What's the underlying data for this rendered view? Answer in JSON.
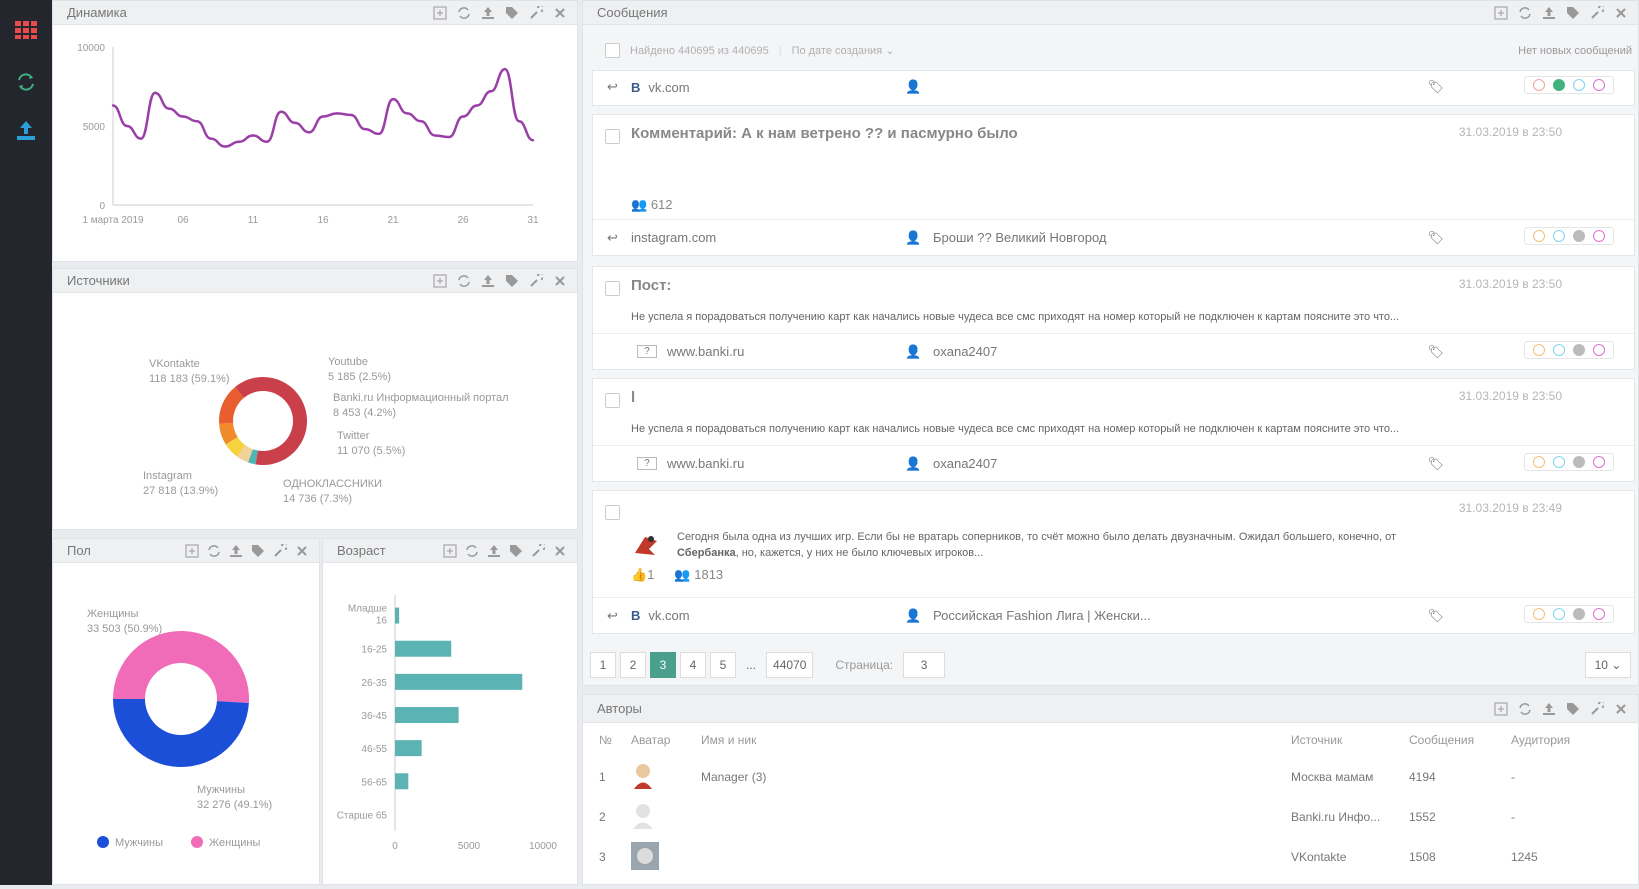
{
  "sidebar": {
    "icons": [
      "grid-icon",
      "refresh-icon",
      "upload-icon"
    ],
    "colors": {
      "grid": "#e84b4b",
      "refresh": "#3fb27f",
      "upload": "#2a9fd8"
    }
  },
  "dynamics": {
    "title": "Динамика",
    "chart_data": {
      "type": "line",
      "x": [
        "1 марта 2019",
        "",
        "",
        "",
        "",
        "06",
        "",
        "",
        "",
        "",
        "11",
        "",
        "",
        "",
        "",
        "16",
        "",
        "",
        "",
        "",
        "21",
        "",
        "",
        "",
        "",
        "26",
        "",
        "",
        "",
        "",
        "31"
      ],
      "series": [
        {
          "values": [
            6300,
            5000,
            4200,
            7100,
            6100,
            5600,
            5300,
            4200,
            3700,
            4000,
            4400,
            4000,
            5900,
            5200,
            4600,
            5600,
            5800,
            5700,
            4800,
            4500,
            6700,
            5800,
            5300,
            4400,
            4300,
            5600,
            6300,
            7200,
            8600,
            5300,
            4100
          ]
        }
      ],
      "ylim": [
        0,
        10000
      ],
      "yticks": [
        "0",
        "5000",
        "10000"
      ],
      "xticks": [
        "1 марта 2019",
        "06",
        "11",
        "16",
        "21",
        "26",
        "31"
      ],
      "color": "#9b3fa8"
    }
  },
  "sources": {
    "title": "Источники",
    "chart_data": {
      "type": "pie",
      "labels": [
        "VKontakte",
        "Youtube",
        "Banki.ru Информационный портал",
        "Twitter",
        "ОДНОКЛАССНИКИ",
        "Instagram"
      ],
      "values": [
        118183,
        5185,
        8453,
        11070,
        14736,
        27818
      ],
      "value_labels": [
        "118 183 (59.1%)",
        "5 185 (2.5%)",
        "8 453 (4.2%)",
        "11 070 (5.5%)",
        "14 736 (7.3%)",
        "27 818 (13.9%)"
      ],
      "colors": [
        "#c9404a",
        "#4db6b0",
        "#f2d29b",
        "#f5d23e",
        "#f08a2a",
        "#e85e2f"
      ]
    }
  },
  "gender": {
    "title": "Пол",
    "chart_data": {
      "type": "pie",
      "labels": [
        "Женщины",
        "Мужчины"
      ],
      "values": [
        33503,
        32276
      ],
      "value_labels": [
        "33 503 (50.9%)",
        "32 276 (49.1%)"
      ],
      "colors": [
        "#f06cb8",
        "#1c4fd8"
      ]
    },
    "legend": [
      "Мужчины",
      "Женщины"
    ]
  },
  "age": {
    "title": "Возраст",
    "chart_data": {
      "type": "bar",
      "categories": [
        "Младше 16",
        "16-25",
        "26-35",
        "36-45",
        "46-55",
        "56-65",
        "Старше 65"
      ],
      "values": [
        280,
        3800,
        8600,
        4300,
        1800,
        900,
        0
      ],
      "xlim": [
        0,
        10000
      ],
      "xticks": [
        "0",
        "5000",
        "10000"
      ],
      "color": "#5bb3b3"
    }
  },
  "messages": {
    "title": "Сообщения",
    "found": "Найдено 440695 из 440695",
    "sort": "По дате создания",
    "status": "Нет новых сообщений",
    "items": [
      {
        "source": "vk.com",
        "author": "",
        "title": ""
      },
      {
        "title": "Комментарий: А к нам ветрено ?? и пасмурно было",
        "date": "31.03.2019 в 23:50",
        "stat": "612",
        "source": "instagram.com",
        "author": "Броши ?? Великий Новгород"
      },
      {
        "title": "Пост:",
        "date": "31.03.2019 в 23:50",
        "text": "Не успела я порадоваться получению карт как начались новые чудеса все смс приходят на номер который не подключен к картам поясните это что...",
        "source": "www.banki.ru",
        "author": "oxana2407"
      },
      {
        "title": "l",
        "date": "31.03.2019 в 23:50",
        "text": "Не успела я порадоваться получению карт как начались новые чудеса все смс приходят на номер который не подключен к картам поясните это что...",
        "source": "www.banki.ru",
        "author": "oxana2407"
      },
      {
        "date": "31.03.2019 в 23:49",
        "text1": "Сегодня была одна из лучших игр. Если бы не вратарь соперников, то счёт можно было делать двузначным. Ожидал большего, конечно, от",
        "text2_bold": "Сбербанка",
        "text2": ", но, кажется, у них не было ключевых игроков...",
        "likes": "1",
        "stat": "1813",
        "source": "vk.com",
        "author": "Российская Fashion Лига | Женски..."
      }
    ],
    "pager": {
      "pages": [
        "1",
        "2",
        "3",
        "4",
        "5",
        "...",
        "44070"
      ],
      "page_label": "Страница:",
      "page_value": "3",
      "per_page": "10"
    }
  },
  "authors": {
    "title": "Авторы",
    "columns": [
      "№",
      "Аватар",
      "Имя и ник",
      "Источник",
      "Сообщения",
      "Аудитория"
    ],
    "rows": [
      {
        "n": "1",
        "name": "Manager (3)",
        "source": "Москва мамам",
        "messages": "4194",
        "audience": "-"
      },
      {
        "n": "2",
        "name": "",
        "source": "Banki.ru Инфо...",
        "messages": "1552",
        "audience": "-"
      },
      {
        "n": "3",
        "name": "",
        "source": "VKontakte",
        "messages": "1508",
        "audience": "1245"
      }
    ]
  }
}
